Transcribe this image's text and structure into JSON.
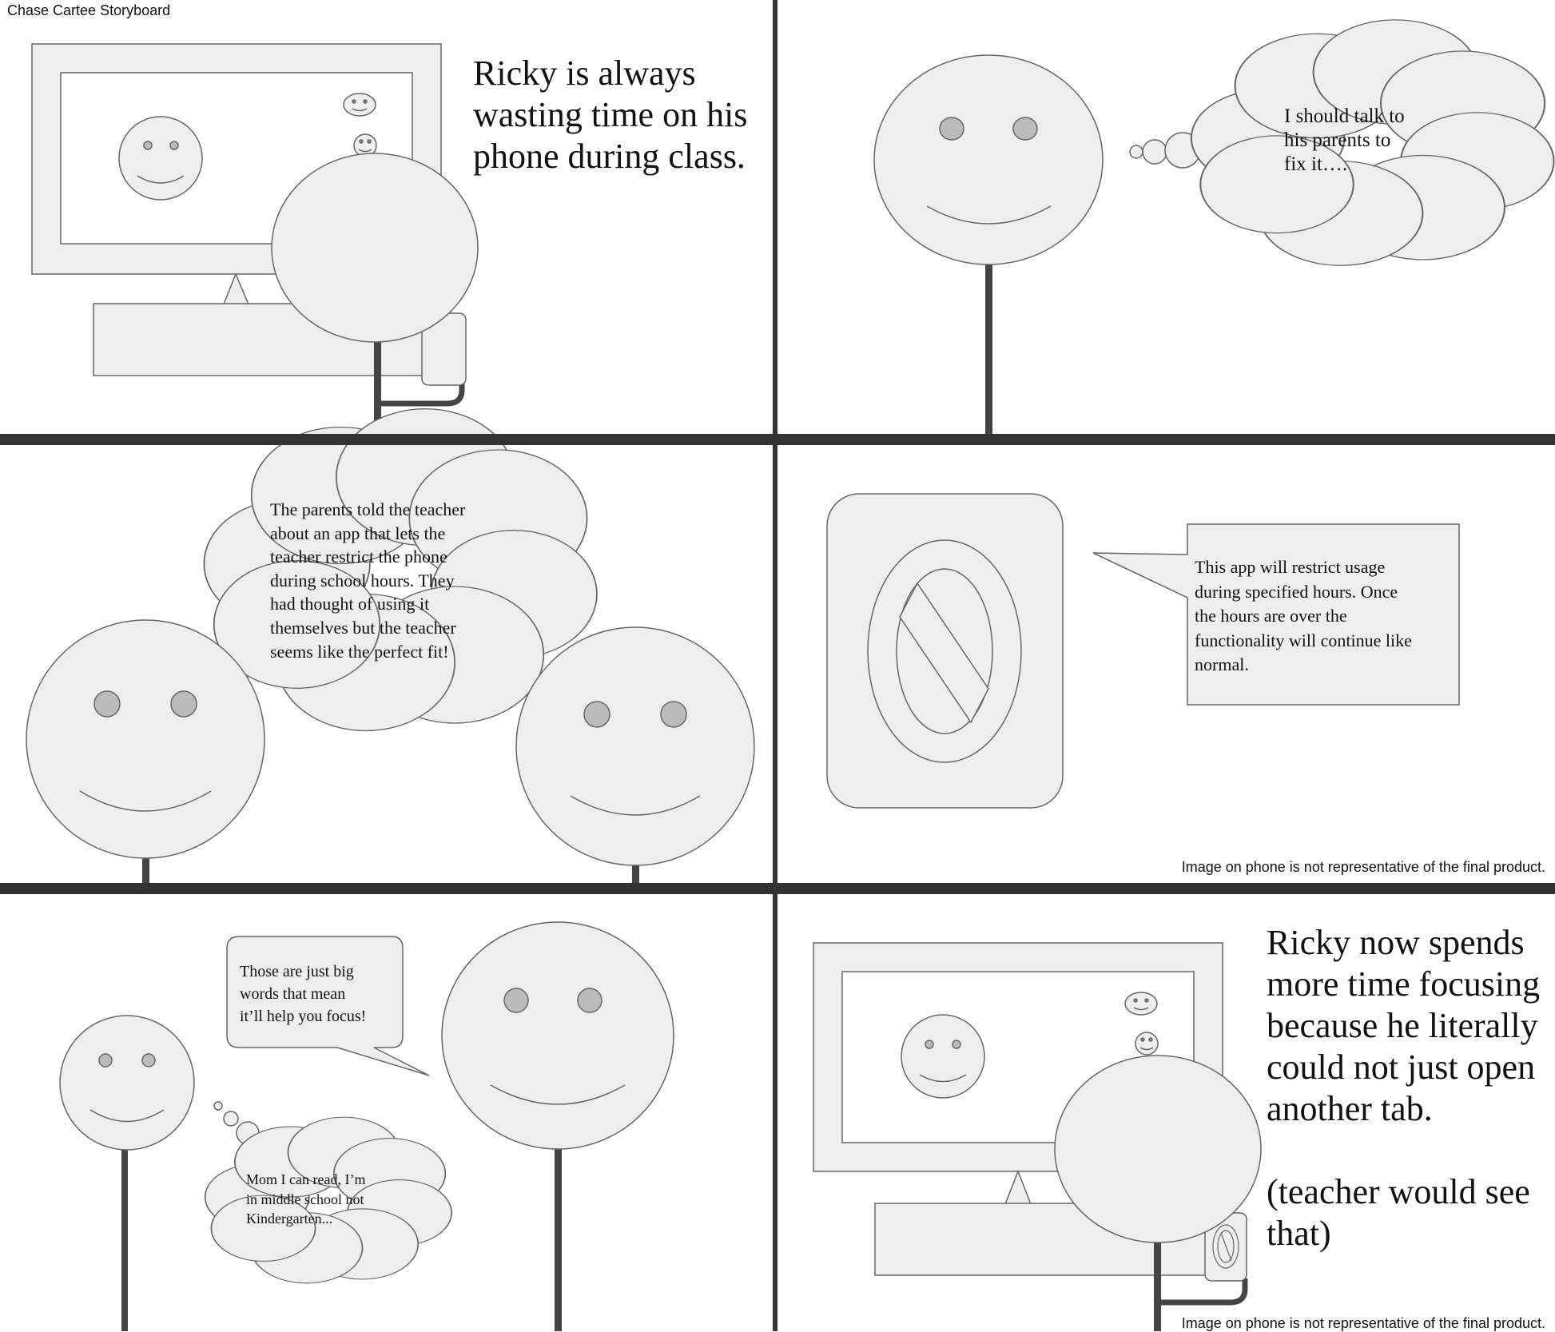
{
  "storyboard": {
    "title": "Chase Cartee Storyboard",
    "colors": {
      "fill": "#eeeeee",
      "stroke": "#666666",
      "eye": "#bbbbbb",
      "divider": "#333333"
    },
    "panels": [
      {
        "id": "panel-1",
        "caption": "Ricky is always\nwasting time on his\nphone during class."
      },
      {
        "id": "panel-2",
        "thought": "I should talk to\nhis parents to\nfix it…."
      },
      {
        "id": "panel-3",
        "thought": "The parents told the teacher\nabout an app that lets the\nteacher restrict the phone\nduring school hours. They\nhad thought of using it\nthemselves but the teacher\nseems like the perfect fit!"
      },
      {
        "id": "panel-4",
        "speech": "This app will restrict usage\nduring specified hours. Once\nthe hours are over the\nfunctionality will continue like\nnormal.",
        "disclaimer": "Image on phone is not representative of the final product.",
        "phone_icon": "prohibited-icon"
      },
      {
        "id": "panel-5",
        "speech": "Those are just big\nwords that mean\nit’ll help you focus!",
        "thought": "Mom I can read, I’m\nin middle school not\nKindergarten..."
      },
      {
        "id": "panel-6",
        "caption": "Ricky now spends\nmore time focusing\nbecause he literally\ncould not just open\nanother tab.\n\n(teacher would see\nthat)",
        "disclaimer": "Image on phone is not representative of the final product.",
        "phone_icon": "prohibited-icon"
      }
    ]
  }
}
